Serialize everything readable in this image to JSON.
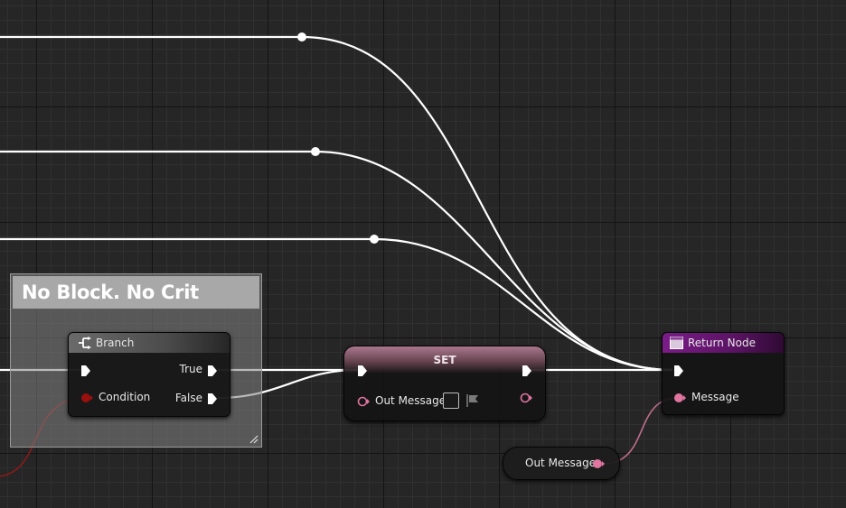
{
  "comment": {
    "title": "No Block. No Crit"
  },
  "branch": {
    "title": "Branch",
    "pins": {
      "condition": "Condition",
      "true": "True",
      "false": "False"
    }
  },
  "set_node": {
    "title": "SET",
    "pins": {
      "out_message": "Out Message"
    }
  },
  "return_node": {
    "title": "Return Node",
    "pins": {
      "message": "Message"
    }
  },
  "getter": {
    "label": "Out Message"
  },
  "colors": {
    "exec_wire": "#ffffff",
    "bool_pin": "#9c0f0f",
    "bool_wire": "#8b1a1a",
    "text_pin": "#e075a0",
    "text_wire": "#c06e8e",
    "return_header": "#7a1c87",
    "set_header": "#a9788e",
    "comment_title_bg": "#a8a8a8"
  },
  "icons": {
    "branch": "branch-icon",
    "return": "function-icon",
    "variable_flag": "flag-icon"
  }
}
